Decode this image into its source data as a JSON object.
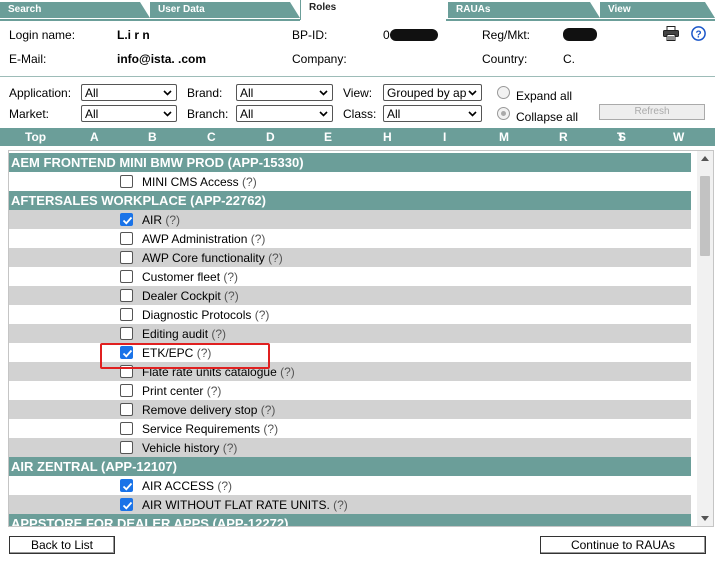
{
  "tabs": [
    "Search",
    "User Data",
    "Roles",
    "RAUAs",
    "View"
  ],
  "active_tab": "Roles",
  "user": {
    "login_label": "Login name:",
    "login_value": "L.i r n",
    "bp_label": "BP-ID:",
    "bp_value": "0",
    "reg_label": "Reg/Mkt:",
    "email_label": "E-Mail:",
    "email_value": "info@ista.      .com",
    "company_label": "Company:",
    "country_label": "Country:",
    "country_value": "C."
  },
  "icons": {
    "print": "printer-icon",
    "help": "help-icon"
  },
  "filters": {
    "application_label": "Application:",
    "application_value": "All",
    "brand_label": "Brand:",
    "brand_value": "All",
    "view_label": "View:",
    "view_value": "Grouped by ap",
    "market_label": "Market:",
    "market_value": "All",
    "branch_label": "Branch:",
    "branch_value": "All",
    "class_label": "Class:",
    "class_value": "All",
    "expand_label": "Expand all",
    "collapse_label": "Collapse all",
    "refresh_label": "Refresh"
  },
  "alphabet": [
    "Top",
    "A",
    "B",
    "C",
    "D",
    "E",
    "H",
    "I",
    "M",
    "R",
    "S",
    "T",
    "W"
  ],
  "list": [
    {
      "type": "group",
      "label": "AEM FRONTEND MINI BMW PROD (APP-15330)"
    },
    {
      "type": "item",
      "label": "MINI CMS Access",
      "help": "(?)",
      "checked": false
    },
    {
      "type": "group",
      "label": "AFTERSALES WORKPLACE (APP-22762)"
    },
    {
      "type": "item",
      "label": "AIR",
      "help": "(?)",
      "checked": true
    },
    {
      "type": "item",
      "label": "AWP Administration",
      "help": "(?)",
      "checked": false
    },
    {
      "type": "item",
      "label": "AWP Core functionality",
      "help": "(?)",
      "checked": false
    },
    {
      "type": "item",
      "label": "Customer fleet",
      "help": "(?)",
      "checked": false
    },
    {
      "type": "item",
      "label": "Dealer Cockpit",
      "help": "(?)",
      "checked": false
    },
    {
      "type": "item",
      "label": "Diagnostic Protocols",
      "help": "(?)",
      "checked": false
    },
    {
      "type": "item",
      "label": "Editing audit",
      "help": "(?)",
      "checked": false
    },
    {
      "type": "item",
      "label": "ETK/EPC",
      "help": "(?)",
      "checked": true
    },
    {
      "type": "item",
      "label": "Flate rate units catalogue",
      "help": "(?)",
      "checked": false
    },
    {
      "type": "item",
      "label": "Print center",
      "help": "(?)",
      "checked": false
    },
    {
      "type": "item",
      "label": "Remove delivery stop",
      "help": "(?)",
      "checked": false
    },
    {
      "type": "item",
      "label": "Service Requirements",
      "help": "(?)",
      "checked": false
    },
    {
      "type": "item",
      "label": "Vehicle history",
      "help": "(?)",
      "checked": false
    },
    {
      "type": "group",
      "label": "AIR ZENTRAL (APP-12107)"
    },
    {
      "type": "item",
      "label": "AIR ACCESS",
      "help": "(?)",
      "checked": true
    },
    {
      "type": "item",
      "label": "AIR WITHOUT FLAT RATE UNITS.",
      "help": "(?)",
      "checked": true
    },
    {
      "type": "group",
      "label": "APPSTORE FOR DEALER APPS (APP-12272)"
    }
  ],
  "buttons": {
    "back": "Back to List",
    "continue": "Continue to RAUAs"
  },
  "colors": {
    "teal": "#6b9e99",
    "row_grey": "#d2d2d2",
    "checkbox": "#1a73e8",
    "highlight": "#e02020"
  }
}
